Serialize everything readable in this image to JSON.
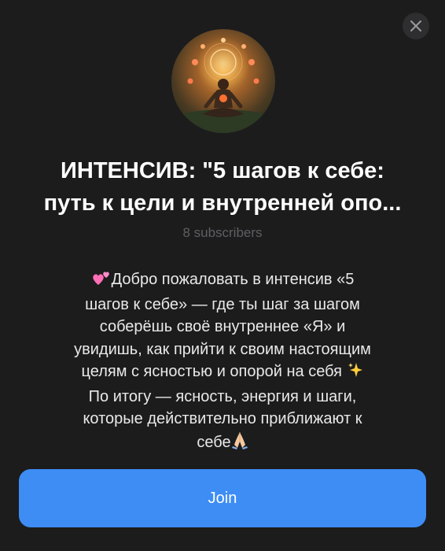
{
  "channel": {
    "title_line1": "ИНТЕНСИВ: \"5 шагов к себе:",
    "title_line2": "путь к цели и внутренней опо...",
    "subscribers": "8 subscribers"
  },
  "description": {
    "line1": "Добро пожаловать в интенсив «5",
    "line2": "шагов к себе» — где ты шаг за шагом",
    "line3": "соберёшь своё внутреннее «Я» и",
    "line4": "увидишь, как прийти к своим настоящим",
    "line5": "целям с ясностью и опорой на себя",
    "line6": "По итогу — ясность, энергия и шаги,",
    "line7": "которые действительно приближают к",
    "line8": "себе"
  },
  "actions": {
    "join_label": "Join"
  },
  "icons": {
    "close": "close-icon",
    "hearts": "two-hearts-icon",
    "sparkles": "sparkles-icon",
    "pray": "praying-hands-icon",
    "avatar": "meditation-avatar"
  },
  "colors": {
    "background": "#1c1c1d",
    "accent": "#3d8df5",
    "muted": "#5f5f63"
  }
}
